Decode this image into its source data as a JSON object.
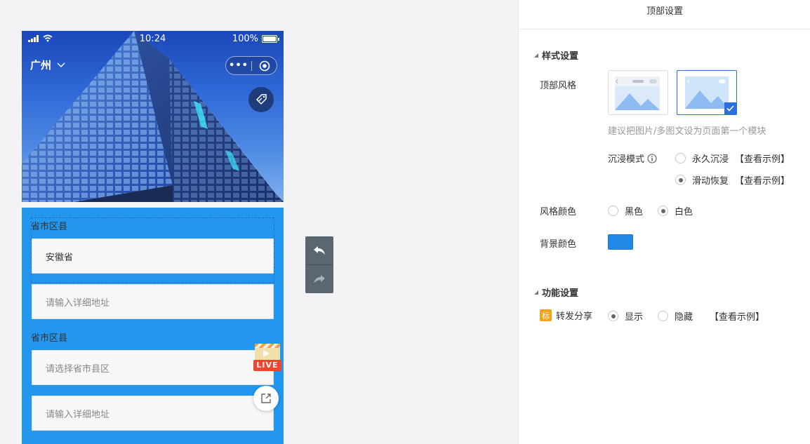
{
  "phone": {
    "status": {
      "time": "10:24",
      "battery": "100%"
    },
    "city": "广州",
    "form": {
      "label1": "省市区县",
      "value1": "安徽省",
      "placeholder1": "请输入详细地址",
      "label2": "省市区县",
      "placeholder2": "请选择省市县区",
      "placeholder3": "请输入详细地址"
    },
    "live_tag": "LIVE"
  },
  "panel": {
    "title": "顶部设置",
    "style_section": {
      "title": "样式设置",
      "top_style_label": "顶部风格",
      "hint": "建议把图片/多图文设为页面第一个模块",
      "immersive_label": "沉浸模式",
      "immersive_options": [
        {
          "label": "永久沉浸",
          "example": "【查看示例】",
          "selected": false
        },
        {
          "label": "滑动恢复",
          "example": "【查看示例】",
          "selected": true
        }
      ],
      "style_color_label": "风格颜色",
      "color_options": [
        {
          "label": "黑色",
          "selected": false
        },
        {
          "label": "白色",
          "selected": true
        }
      ],
      "bg_color_label": "背景颜色",
      "bg_color": "#2389e8"
    },
    "func_section": {
      "title": "功能设置",
      "badge": "标",
      "share_label": "转发分享",
      "share_options": [
        {
          "label": "显示",
          "selected": true
        },
        {
          "label": "隐藏",
          "selected": false
        }
      ],
      "example": "【查看示例】"
    }
  }
}
